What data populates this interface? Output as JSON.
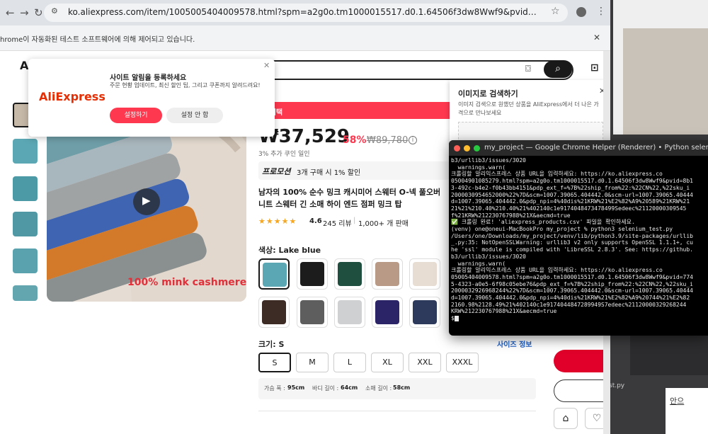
{
  "browser": {
    "url": "ko.aliexpress.com/item/1005005404009578.html?spm=a2g0o.tm1000015517.d0.1.64506f3dw8Wwf9&pvid=7741d0a8-1fb5-4323-a0e...",
    "infobar_text": "hrome이 자동화된 테스트 소프트웨어에 의해 제어되고 있습니다."
  },
  "notification_popup": {
    "logo": "AliExpress",
    "title": "사이트 알림을 등록하세요",
    "body": "주문 현황 업데이트, 최신 할인 팁, 그리고 쿠폰까지 알려드려요!",
    "allow_label": "설정하기",
    "deny_label": "설정 안 함"
  },
  "image_search": {
    "title": "이미지로 검색하기",
    "description": "이미지 검색으로 원했던 상품을 AliExpress에서 더 나은 가격으로 만나보세요"
  },
  "product": {
    "promo_banner": "이 혜택",
    "price": "₩37,529",
    "discount": "58%",
    "old_price": "₩89,780",
    "coupon_note": "3% 추가 쿠인 일인",
    "promotion_label": "프로모션",
    "promotion_desc": "3개 구매 시 1% 할인",
    "title": "남자의 100% 순수 밍크 캐시미어 스웨터 O-넥 풀오버 니트 스웨터 긴 소매 하이 엔드 점퍼 밍크 탑",
    "stars": "★★★★★",
    "rating": "4.6",
    "reviews": "245 리뷰",
    "sold": "1,000+ 개 판매",
    "image_caption": "100% mink cashmere",
    "color_label": "색상: Lake blue",
    "colors": [
      "#5ba7b3",
      "#1c1c1c",
      "#1f4f3e",
      "#b89a86",
      "#e8ddd2",
      "#3d2b26",
      "#5e5e5e",
      "#cfd0d2",
      "#2b2466",
      "#2e3a5c"
    ],
    "size_label": "크기: S",
    "size_guide": "사이즈 정보",
    "sizes": [
      "S",
      "M",
      "L",
      "XL",
      "XXL",
      "XXXL"
    ],
    "measure_chest_label": "가슴 폭 :",
    "measure_chest": "95cm",
    "measure_length_label": "바디 길이 :",
    "measure_length": "64cm",
    "measure_sleeve_label": "소매 길이 :",
    "measure_sleeve": "58cm"
  },
  "right_app": {
    "file_label": "st.py",
    "link_text": "안으"
  },
  "terminal": {
    "title": "my_project — Google Chrome Helper (Renderer) • Python selenium_",
    "lines": [
      "b3/urllib3/issues/3020",
      "  warnings.warn(",
      "크롤링할 알리익스프레스 상품 URL을 입력하세요: https://ko.aliexpress.co",
      "05004901085279.html?spm=a2g0o.tm1000015517.d0.1.64506f3dw8Wwf9&pvid=8b1",
      "3-492c-b4e2-f0b43bb4151&pdp_ext_f=%7B%22ship_from%22:%22CN%22,%22sku_i",
      "2000030954652000%22%7D&scm=1007.39065.404442.0&scm-url=1007.39065.40444",
      "d=1007.39065.404442.0&pdp_npi=4%40dis%21KRW%21%E2%82%A9%20589%21KRW%21",
      "21%21%210.40%210.40%21%402140c1e9174048473478499Sedeec%21120000309545",
      "f%21KRW%212230767988%21X&aecmd=true",
      "✅ 크롤링 완료! 'aliexpress_products.csv' 파일을 확인하세요.",
      "(venv) one@oneui-MacBookPro my_project % python3 selenium_test.py",
      "/Users/one/Downloads/my_project/venv/lib/python3.9/site-packages/urllib",
      "_.py:35: NotOpenSSLWarning: urllib3 v2 only supports OpenSSL 1.1.1+, cu",
      "he 'ssl' module is compiled with 'LibreSSL 2.8.3'. See: https://github.",
      "b3/urllib3/issues/3020",
      "  warnings.warn(",
      "크롤링할 알리익스프레스 상품 URL을 입력하세요: https://ko.aliexpress.co",
      "05005404009578.html?spm=a2g0o.tm1000015517.d0.1.64506f3dw8Wwf9&pvid=774",
      "5-4323-a0e5-6f98c05ebe76&pdp_ext_f=%7B%22ship_from%22:%22CN%22,%22sku_i",
      "2000032926968244%22%7D&scm=1007.39065.404442.0&scm-url=1007.39065.40444",
      "d=1007.39065.404442.0&pdp_npi=4%40dis%21KRW%21%E2%82%A9%20744%21%E2%82",
      "2160.98%2128.49%21%402140c1e9174044847289949S7edeec%21120000329268244",
      "KRW%212230767988%21X&aecmd=true",
      "$"
    ]
  }
}
